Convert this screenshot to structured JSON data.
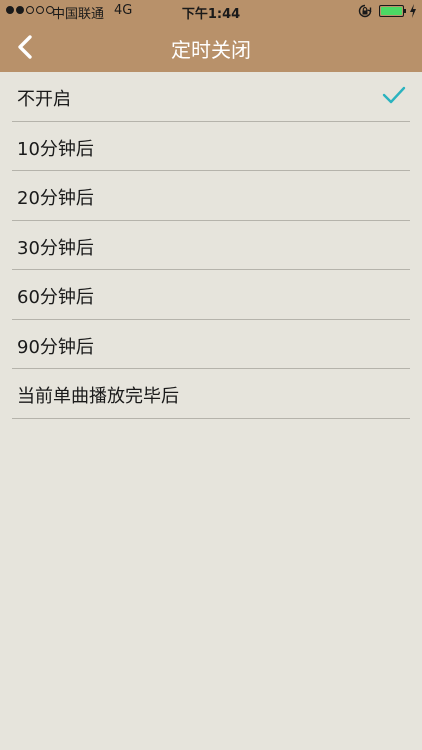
{
  "status_bar": {
    "carrier": "中国联通",
    "network": "4G",
    "time": "下午1:44"
  },
  "nav": {
    "title": "定时关闭"
  },
  "options": [
    {
      "label": "不开启",
      "selected": true
    },
    {
      "label": "10分钟后",
      "selected": false
    },
    {
      "label": "20分钟后",
      "selected": false
    },
    {
      "label": "30分钟后",
      "selected": false
    },
    {
      "label": "60分钟后",
      "selected": false
    },
    {
      "label": "90分钟后",
      "selected": false
    },
    {
      "label": "当前单曲播放完毕后",
      "selected": false
    }
  ],
  "colors": {
    "header": "#b8916a",
    "background": "#e6e4dc",
    "check": "#2bb3bf",
    "battery": "#4cd964"
  },
  "icons": {
    "back": "chevron-left-icon",
    "check": "checkmark-icon",
    "lock": "orientation-lock-icon",
    "battery": "battery-icon",
    "charge": "charging-bolt-icon"
  }
}
